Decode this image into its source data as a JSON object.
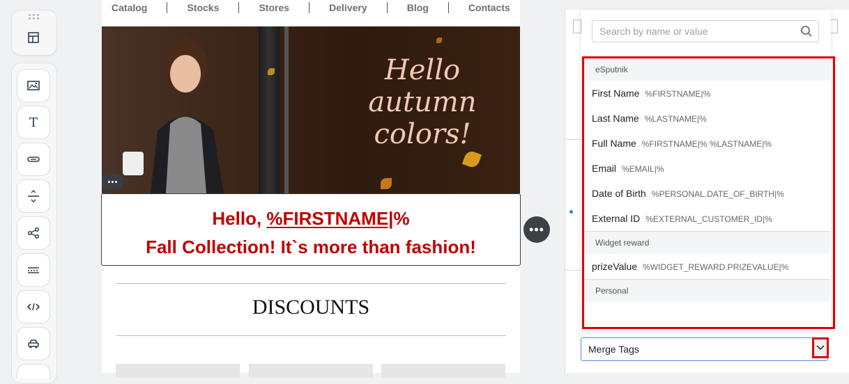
{
  "nav": {
    "items": [
      "Catalog",
      "Stocks",
      "Stores",
      "Delivery",
      "Blog",
      "Contacts"
    ]
  },
  "hero": {
    "headline_line1": "Hello",
    "headline_line2": "autumn",
    "headline_line3": "colors!"
  },
  "textblock": {
    "greeting_prefix": "Hello, ",
    "merge_tag": "%FIRSTNAME|",
    "greeting_suffix": "%",
    "line2": "Fall Collection! It`s more than fashion!"
  },
  "section": {
    "title": "DISCOUNTS"
  },
  "toolbar": {
    "icons": [
      "layout-icon",
      "image-icon",
      "text-icon",
      "button-icon",
      "spacer-icon",
      "social-icon",
      "divider-icon",
      "code-icon",
      "car-icon"
    ]
  },
  "merge_panel": {
    "search_placeholder": "Search by name or value",
    "groups": [
      {
        "name": "eSputnik",
        "items": [
          {
            "label": "First Name",
            "value": "%FIRSTNAME|%"
          },
          {
            "label": "Last Name",
            "value": "%LASTNAME|%"
          },
          {
            "label": "Full Name",
            "value": "%FIRSTNAME|% %LASTNAME|%"
          },
          {
            "label": "Email",
            "value": "%EMAIL|%"
          },
          {
            "label": "Date of Birth",
            "value": "%PERSONAL.DATE_OF_BIRTH|%"
          },
          {
            "label": "External ID",
            "value": "%EXTERNAL_CUSTOMER_ID|%"
          }
        ]
      },
      {
        "name": "Widget reward",
        "items": [
          {
            "label": "prizeValue",
            "value": "%WIDGET_REWARD.PRIZEVALUE|%"
          }
        ]
      },
      {
        "name": "Personal",
        "items": []
      }
    ],
    "select_label": "Merge Tags"
  },
  "colors": {
    "highlight": "#e00000",
    "text_red": "#c00000",
    "accent_blue": "#4a8fe0"
  }
}
